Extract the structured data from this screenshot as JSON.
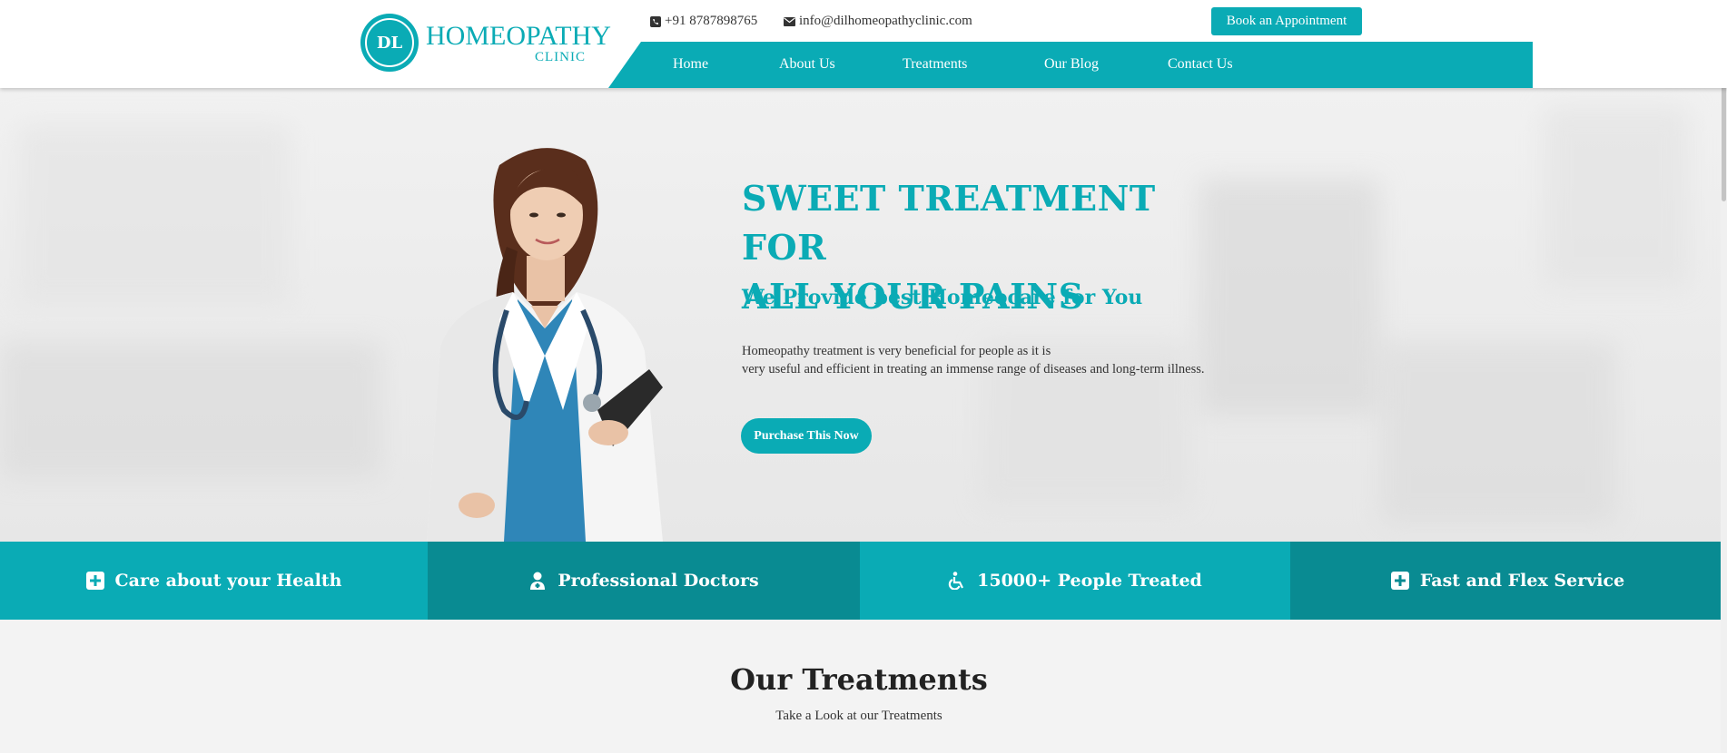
{
  "brand": {
    "title": "HOMEOPATHY",
    "subtitle": "CLINIC",
    "monogram": "DL",
    "color": "#0aabb5",
    "dark_color": "#098b92"
  },
  "topbar": {
    "phone": "+91 8787898765",
    "email": "info@dilhomeopathyclinic.com",
    "phone_icon": "phone-square-icon",
    "email_icon": "envelope-icon",
    "appointment_label": "Book an Appointment"
  },
  "nav": {
    "items": [
      {
        "label": "Home"
      },
      {
        "label": "About Us"
      },
      {
        "label": "Treatments"
      },
      {
        "label": "Our Blog"
      },
      {
        "label": "Contact Us"
      }
    ]
  },
  "hero": {
    "title_line1": "SWEET TREATMENT FOR",
    "title_line2": "ALL YOUR PAINS",
    "subtitle": "We Provide best Homeocare for You",
    "text_line1": "Homeopathy treatment is very beneficial for people as it is",
    "text_line2": "very useful and efficient in treating an immense range of diseases and long-term illness.",
    "button_label": "Purchase This Now"
  },
  "features": [
    {
      "label": "Care about your Health",
      "icon": "plus-square-icon"
    },
    {
      "label": "Professional Doctors",
      "icon": "doctor-icon"
    },
    {
      "label": "15000+ People Treated",
      "icon": "wheelchair-icon"
    },
    {
      "label": "Fast and Flex Service",
      "icon": "plus-square-icon"
    }
  ],
  "treatments": {
    "title": "Our Treatments",
    "subtitle": "Take a Look at our Treatments"
  }
}
